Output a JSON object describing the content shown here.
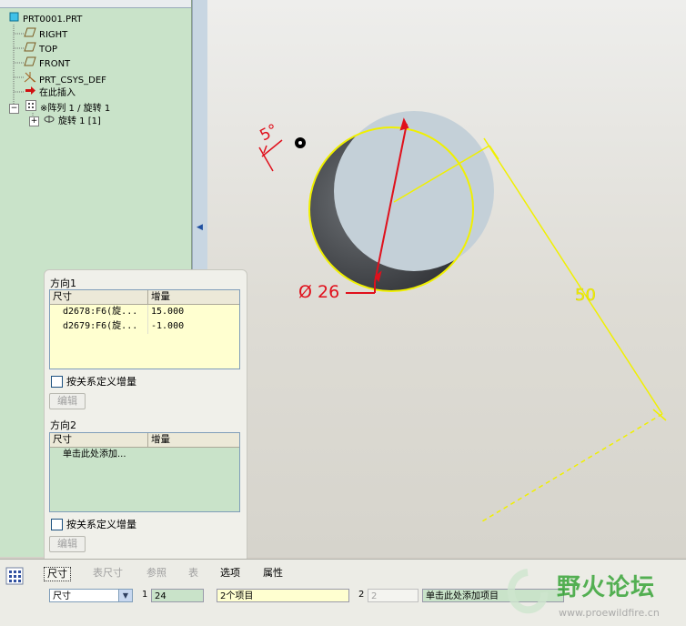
{
  "model_tree": {
    "items": [
      {
        "label": "PRT0001.PRT",
        "icon": "part-icon"
      },
      {
        "label": "RIGHT",
        "icon": "datum-plane-icon"
      },
      {
        "label": "TOP",
        "icon": "datum-plane-icon"
      },
      {
        "label": "FRONT",
        "icon": "datum-plane-icon"
      },
      {
        "label": "PRT_CSYS_DEF",
        "icon": "csys-icon"
      },
      {
        "label": "在此插入",
        "icon": "insert-here-arrow-icon"
      },
      {
        "label": "※阵列 1 / 旋转 1",
        "icon": "pattern-icon"
      },
      {
        "label": "旋转 1 [1]",
        "icon": "revolve-icon"
      }
    ]
  },
  "graphics": {
    "dimension_angle": "5°",
    "dimension_diameter": "Ø 26",
    "dimension_length": "50"
  },
  "panel": {
    "direction1_title": "方向1",
    "direction2_title": "方向2",
    "col_dimension": "尺寸",
    "col_increment": "增量",
    "direction1_rows": [
      {
        "dimension": "d2678:F6(旋...",
        "increment": "15.000"
      },
      {
        "dimension": "d2679:F6(旋...",
        "increment": "-1.000"
      }
    ],
    "direction2_placeholder": "单击此处添加...",
    "relation_checkbox_label": "按关系定义增量",
    "edit_button_label": "编辑"
  },
  "dashboard": {
    "tabs": [
      "尺寸",
      "表尺寸",
      "参照",
      "表",
      "选项",
      "属性"
    ],
    "type_select_value": "尺寸",
    "dir1_index": "1",
    "dir1_count": "24",
    "dir1_items": "2个项目",
    "dir2_index": "2",
    "dir2_count": "2",
    "dir2_items": "单击此处添加项目"
  },
  "watermark": {
    "title": "野火论坛",
    "url": "www.proewildfire.cn"
  },
  "colors": {
    "tree_bg": "#c9e3c9",
    "dimension_red": "#e0101c",
    "edge_yellow": "#f0f000",
    "face_blue": "#c4d0d8"
  }
}
